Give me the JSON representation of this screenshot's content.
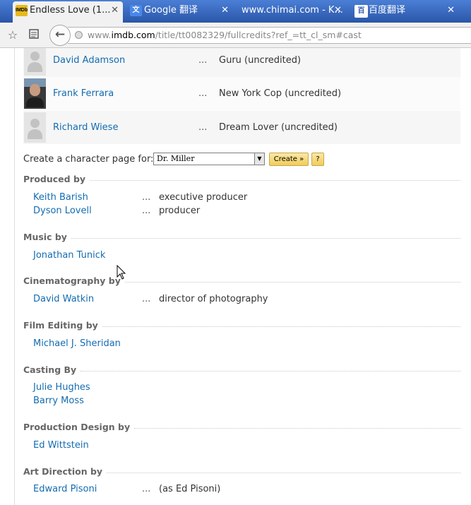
{
  "tabs": [
    {
      "label": "Endless Love (1...",
      "favicon": "IMDb",
      "active": true
    },
    {
      "label": "Google 翻译",
      "favicon": "文",
      "active": false
    },
    {
      "label": "www.chimai.com - K...",
      "favicon": "",
      "active": false
    },
    {
      "label": "百度翻译",
      "favicon": "百",
      "active": false
    }
  ],
  "toolbar": {
    "url_prefix": "www.",
    "url_host": "imdb.com",
    "url_path": "/title/tt0082329/fullcredits?ref_=tt_cl_sm#cast"
  },
  "cast": [
    {
      "name": "David Adamson",
      "dots": "...",
      "character": "Guru (uncredited)"
    },
    {
      "name": "Frank Ferrara",
      "dots": "...",
      "character": "New York Cop (uncredited)"
    },
    {
      "name": "Richard Wiese",
      "dots": "...",
      "character": "Dream Lover (uncredited)"
    }
  ],
  "create_character": {
    "label": "Create a character page for:",
    "selected": "Dr. Miller",
    "create_button": "Create »",
    "help_button": "?"
  },
  "sections": {
    "produced": {
      "title": "Produced by",
      "rows": [
        {
          "name": "Keith Barish",
          "dots": "...",
          "credit": "executive producer"
        },
        {
          "name": "Dyson Lovell",
          "dots": "...",
          "credit": "producer"
        }
      ]
    },
    "music": {
      "title": "Music by",
      "rows": [
        {
          "name": "Jonathan Tunick"
        }
      ]
    },
    "cinematography": {
      "title": "Cinematography by",
      "rows": [
        {
          "name": "David Watkin",
          "dots": "...",
          "credit": "director of photography"
        }
      ]
    },
    "editing": {
      "title": "Film Editing by",
      "rows": [
        {
          "name": "Michael J. Sheridan"
        }
      ]
    },
    "casting": {
      "title": "Casting By",
      "rows": [
        {
          "name": "Julie Hughes"
        },
        {
          "name": "Barry Moss"
        }
      ]
    },
    "production_design": {
      "title": "Production Design by",
      "rows": [
        {
          "name": "Ed Wittstein"
        }
      ]
    },
    "art_direction": {
      "title": "Art Direction by",
      "rows": [
        {
          "name": "Edward Pisoni",
          "dots": "...",
          "credit": "(as Ed Pisoni)"
        }
      ]
    }
  },
  "colors": {
    "link": "#136cb2",
    "tabstrip": "#2a56a8",
    "button": "#f2cc5a"
  }
}
